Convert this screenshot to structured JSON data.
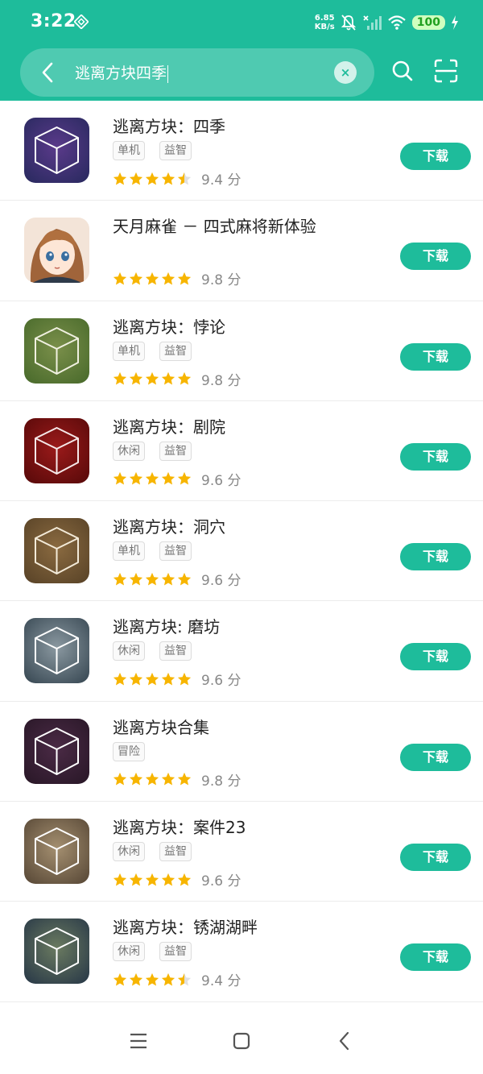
{
  "status_bar": {
    "time": "3:22",
    "net_speed_value": "6.85",
    "net_speed_unit": "KB/s",
    "battery": "100"
  },
  "search": {
    "query": "逃离方块四季",
    "clear_symbol": "×"
  },
  "colors": {
    "accent": "#1ebc9b",
    "star": "#f7b500",
    "star_empty": "#e0e0e0"
  },
  "download_label": "下载",
  "score_unit": "分",
  "apps": [
    {
      "title": "逃离方块：四季",
      "tags": [
        "单机",
        "益智"
      ],
      "score": "9.4",
      "stars": 4.5,
      "icon": "cube-icon-seasons"
    },
    {
      "title": "天月麻雀 － 四式麻将新体验",
      "tags": [],
      "score": "9.8",
      "stars": 5,
      "icon": "anime-girl-icon"
    },
    {
      "title": "逃离方块：悖论",
      "tags": [
        "单机",
        "益智"
      ],
      "score": "9.8",
      "stars": 5,
      "icon": "cube-icon-paradox"
    },
    {
      "title": "逃离方块：剧院",
      "tags": [
        "休闲",
        "益智"
      ],
      "score": "9.6",
      "stars": 5,
      "icon": "cube-icon-theatre"
    },
    {
      "title": "逃离方块：洞穴",
      "tags": [
        "单机",
        "益智"
      ],
      "score": "9.6",
      "stars": 5,
      "icon": "cube-icon-cave"
    },
    {
      "title": "逃离方块: 磨坊",
      "tags": [
        "休闲",
        "益智"
      ],
      "score": "9.6",
      "stars": 5,
      "icon": "cube-icon-mill"
    },
    {
      "title": "逃离方块合集",
      "tags": [
        "冒险"
      ],
      "score": "9.8",
      "stars": 5,
      "icon": "cube-icon-collection"
    },
    {
      "title": "逃离方块：案件23",
      "tags": [
        "休闲",
        "益智"
      ],
      "score": "9.6",
      "stars": 5,
      "icon": "cube-icon-case23"
    },
    {
      "title": "逃离方块：锈湖湖畔",
      "tags": [
        "休闲",
        "益智"
      ],
      "score": "9.4",
      "stars": 4.5,
      "icon": "cube-icon-lakeside"
    }
  ]
}
